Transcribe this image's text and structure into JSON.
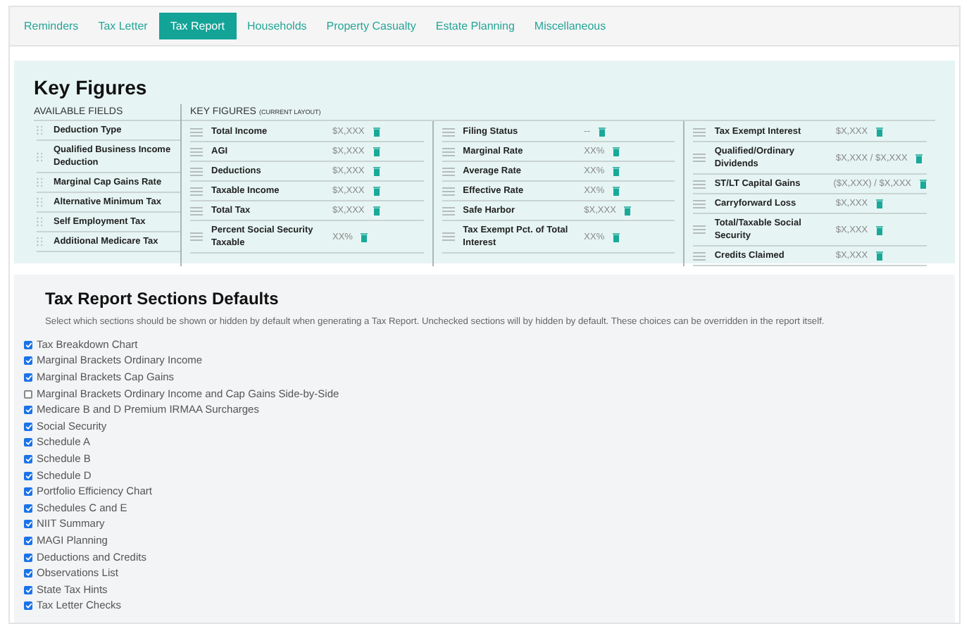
{
  "tabs": [
    {
      "label": "Reminders",
      "selected": false
    },
    {
      "label": "Tax Letter",
      "selected": false
    },
    {
      "label": "Tax Report",
      "selected": true
    },
    {
      "label": "Households",
      "selected": false
    },
    {
      "label": "Property Casualty",
      "selected": false
    },
    {
      "label": "Estate Planning",
      "selected": false
    },
    {
      "label": "Miscellaneous",
      "selected": false
    }
  ],
  "key_figures": {
    "title": "Key Figures",
    "available_fields": {
      "heading": "AVAILABLE FIELDS",
      "items": [
        "Deduction Type",
        "Qualified Business Income Deduction",
        "Marginal Cap Gains Rate",
        "Alternative Minimum Tax",
        "Self Employment Tax",
        "Additional Medicare Tax"
      ]
    },
    "current_layout": {
      "heading": "KEY FIGURES",
      "note": "(CURRENT LAYOUT)",
      "columns": [
        [
          {
            "label": "Total Income",
            "value": "$X,XXX"
          },
          {
            "label": "AGI",
            "value": "$X,XXX"
          },
          {
            "label": "Deductions",
            "value": "$X,XXX"
          },
          {
            "label": "Taxable Income",
            "value": "$X,XXX"
          },
          {
            "label": "Total Tax",
            "value": "$X,XXX"
          },
          {
            "label": "Percent Social Security Taxable",
            "value": "XX%"
          }
        ],
        [
          {
            "label": "Filing Status",
            "value": "--"
          },
          {
            "label": "Marginal Rate",
            "value": "XX%"
          },
          {
            "label": "Average Rate",
            "value": "XX%"
          },
          {
            "label": "Effective Rate",
            "value": "XX%"
          },
          {
            "label": "Safe Harbor",
            "value": "$X,XXX"
          },
          {
            "label": "Tax Exempt Pct. of Total Interest",
            "value": "XX%"
          }
        ],
        [
          {
            "label": "Tax Exempt Interest",
            "value": "$X,XXX"
          },
          {
            "label": "Qualified/Ordinary Dividends",
            "value": "$X,XXX / $X,XXX"
          },
          {
            "label": "ST/LT Capital Gains",
            "value": "($X,XXX) / $X,XXX"
          },
          {
            "label": "Carryforward Loss",
            "value": "$X,XXX"
          },
          {
            "label": "Total/Taxable Social Security",
            "value": "$X,XXX"
          },
          {
            "label": "Credits Claimed",
            "value": "$X,XXX"
          }
        ]
      ]
    }
  },
  "sections": {
    "title": "Tax Report Sections Defaults",
    "description": "Select which sections should be shown or hidden by default when generating a Tax Report. Unchecked sections will by hidden by default. These choices can be overridden in the report itself.",
    "items": [
      {
        "label": "Tax Breakdown Chart",
        "checked": true
      },
      {
        "label": "Marginal Brackets Ordinary Income",
        "checked": true
      },
      {
        "label": "Marginal Brackets Cap Gains",
        "checked": true
      },
      {
        "label": "Marginal Brackets Ordinary Income and Cap Gains Side-by-Side",
        "checked": false
      },
      {
        "label": "Medicare B and D Premium IRMAA Surcharges",
        "checked": true
      },
      {
        "label": "Social Security",
        "checked": true
      },
      {
        "label": "Schedule A",
        "checked": true
      },
      {
        "label": "Schedule B",
        "checked": true
      },
      {
        "label": "Schedule D",
        "checked": true
      },
      {
        "label": "Portfolio Efficiency Chart",
        "checked": true
      },
      {
        "label": "Schedules C and E",
        "checked": true
      },
      {
        "label": "NIIT Summary",
        "checked": true
      },
      {
        "label": "MAGI Planning",
        "checked": true
      },
      {
        "label": "Deductions and Credits",
        "checked": true
      },
      {
        "label": "Observations List",
        "checked": true
      },
      {
        "label": "State Tax Hints",
        "checked": true
      },
      {
        "label": "Tax Letter Checks",
        "checked": true
      }
    ]
  }
}
